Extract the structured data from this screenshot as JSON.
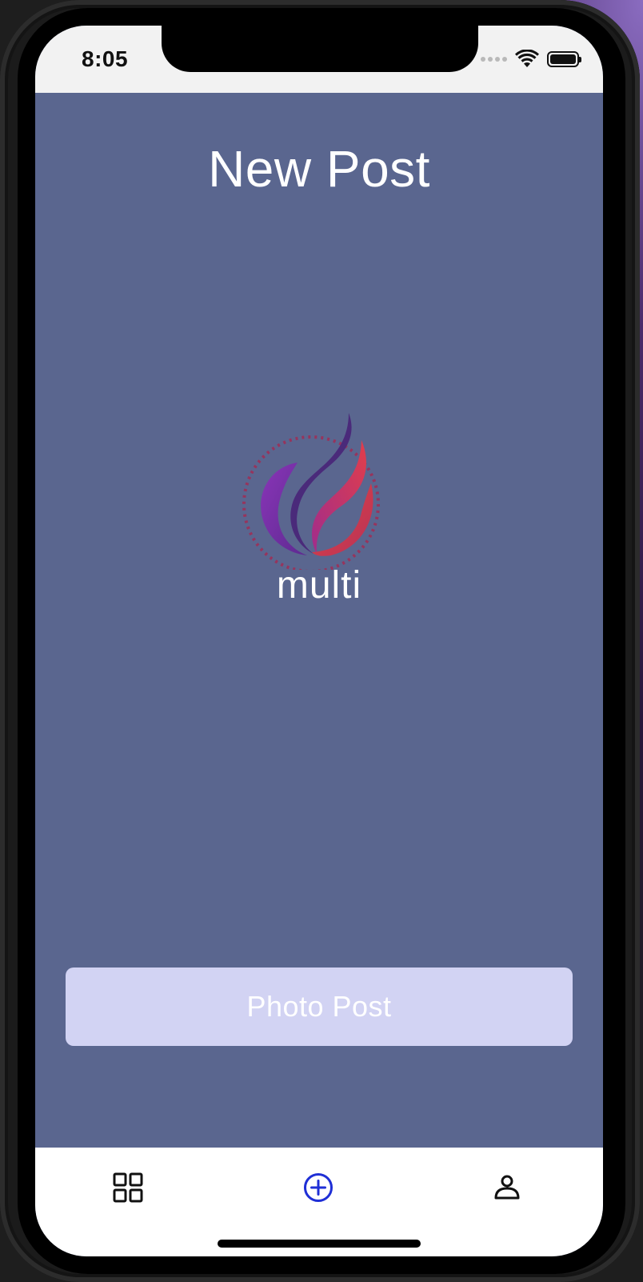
{
  "status_bar": {
    "time": "8:05"
  },
  "screen": {
    "title": "New Post"
  },
  "logo": {
    "text": "multi"
  },
  "photo_post_button": {
    "label": "Photo Post"
  },
  "tab_bar": {
    "tabs": [
      {
        "id": "feed",
        "icon": "grid-icon"
      },
      {
        "id": "new-post",
        "icon": "plus-circle-icon",
        "active": true
      },
      {
        "id": "profile",
        "icon": "person-icon"
      }
    ],
    "active_color": "#1f2fd6",
    "inactive_color": "#111111"
  },
  "colors": {
    "background": "#5a668f",
    "button": "#d2d3f3",
    "status_bar": "#f2f2f2"
  }
}
